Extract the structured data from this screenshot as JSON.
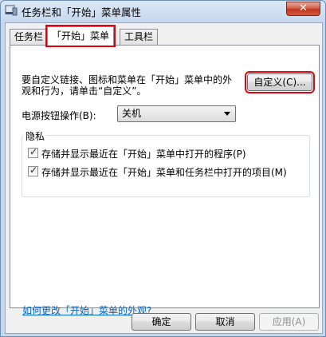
{
  "window": {
    "title": "任务栏和「开始」菜单属性",
    "close_glyph": "✕",
    "icon": "taskbar-icon"
  },
  "tabs": [
    {
      "label": "任务栏",
      "active": false
    },
    {
      "label": "「开始」菜单",
      "active": true
    },
    {
      "label": "工具栏",
      "active": false
    }
  ],
  "start_menu": {
    "description": "要自定义链接、图标和菜单在「开始」菜单中的外观和行为，请单击“自定义”。",
    "customize_button": "自定义(C)...",
    "power_label": "电源按钮操作(B):",
    "power_value": "关机",
    "privacy": {
      "title": "隐私",
      "items": [
        {
          "label": "存储并显示最近在「开始」菜单中打开的程序(P)",
          "checked": true,
          "check_glyph": "✓"
        },
        {
          "label": "存储并显示最近在「开始」菜单和任务栏中打开的项目(M)",
          "checked": true,
          "check_glyph": "✓"
        }
      ]
    },
    "help_link": "如何更改「开始」菜单的外观?"
  },
  "buttons": {
    "ok": "确定",
    "cancel": "取消",
    "apply": "应用(A)"
  },
  "colors": {
    "highlight_outline": "#e3000f",
    "link": "#0066cc",
    "close_button": "#c0391f"
  }
}
